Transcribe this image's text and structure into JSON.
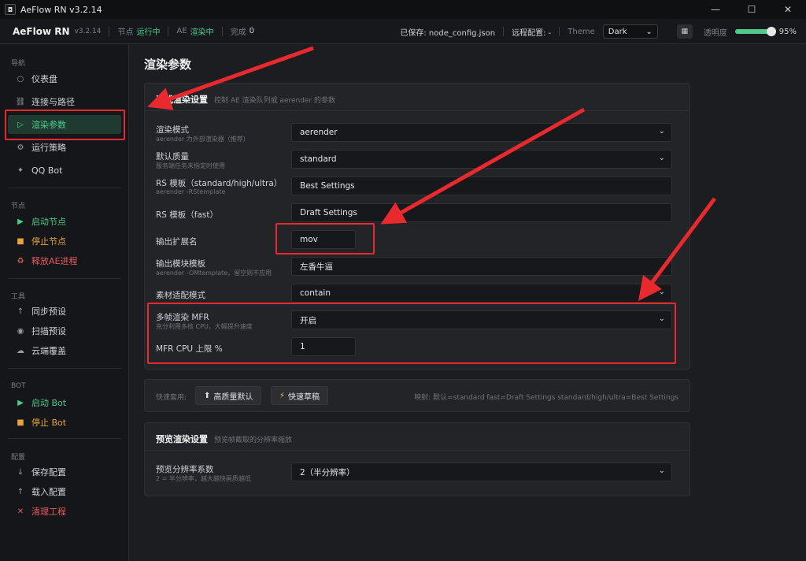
{
  "window": {
    "title": "AeFlow RN  v3.2.14",
    "logo_glyph": "◘"
  },
  "header": {
    "brand": "AeFlow RN",
    "version": "v3.2.14",
    "node_label": "节点",
    "node_value": "运行中",
    "ae_label": "AE",
    "ae_value": "渲染中",
    "done_label": "完成",
    "done_value": "0",
    "saved": "已保存: node_config.json",
    "remote": "远程配置: -",
    "theme_label": "Theme",
    "theme_value": "Dark",
    "opacity_label": "透明度",
    "opacity_value": "95%",
    "opacity_fraction": 0.95,
    "accent_color": "#4ecb8a"
  },
  "sidebar": {
    "sections": [
      {
        "title": "导航",
        "items": [
          {
            "label": "仪表盘",
            "icon": "circle-icon"
          },
          {
            "label": "连接与路径",
            "icon": "link-icon"
          },
          {
            "label": "渲染参数",
            "icon": "play-outline-icon",
            "active": true
          },
          {
            "label": "运行策略",
            "icon": "gear-icon"
          },
          {
            "label": "QQ Bot",
            "icon": "sparkle-icon"
          }
        ]
      },
      {
        "title": "节点",
        "items": [
          {
            "label": "启动节点",
            "icon": "play-icon"
          },
          {
            "label": "停止节点",
            "icon": "stop-icon"
          },
          {
            "label": "释放AE进程",
            "icon": "recycle-icon"
          }
        ]
      },
      {
        "title": "工具",
        "items": [
          {
            "label": "同步预设",
            "icon": "arrow-up-icon"
          },
          {
            "label": "扫描预设",
            "icon": "radio-icon"
          },
          {
            "label": "云端覆盖",
            "icon": "cloud-icon"
          }
        ]
      },
      {
        "title": "BOT",
        "items": [
          {
            "label": "启动 Bot",
            "icon": "play-icon"
          },
          {
            "label": "停止 Bot",
            "icon": "stop-icon"
          }
        ]
      },
      {
        "title": "配置",
        "items": [
          {
            "label": "保存配置",
            "icon": "arrow-down-icon"
          },
          {
            "label": "载入配置",
            "icon": "arrow-up-icon"
          },
          {
            "label": "清理工程",
            "icon": "close-icon"
          }
        ]
      }
    ]
  },
  "main": {
    "page_title": "渲染参数",
    "render_card": {
      "title": "正式渲染设置",
      "subtitle": "控制 AE 渲染队列或 aerender 的参数",
      "rows": [
        {
          "label": "渲染模式",
          "hint": "aerender 为外部渲染器（推荐）",
          "value": "aerender",
          "type": "select"
        },
        {
          "label": "默认质量",
          "hint": "服务端任务未指定时使用",
          "value": "standard",
          "type": "select"
        },
        {
          "label": "RS 模板（standard/high/ultra）",
          "hint": "aerender -RStemplate",
          "value": "Best Settings",
          "type": "input"
        },
        {
          "label": "RS 模板（fast）",
          "hint": "",
          "value": "Draft Settings",
          "type": "input"
        },
        {
          "label": "输出扩展名",
          "hint": "",
          "value": "mov",
          "type": "short"
        },
        {
          "label": "输出模块模板",
          "hint": "aerender -OMtemplate，留空则不应用",
          "value": "左香牛逼",
          "type": "input"
        },
        {
          "label": "素材适配模式",
          "hint": "",
          "value": "contain",
          "type": "select"
        },
        {
          "label": "多帧渲染 MFR",
          "hint": "充分利用多核 CPU，大幅提升速度",
          "value": "开启",
          "type": "select"
        },
        {
          "label": "MFR CPU 上限 %",
          "hint": "",
          "value": "1",
          "type": "short"
        }
      ]
    },
    "quick": {
      "label": "快速套用:",
      "btn_high": "高质量默认",
      "btn_draft": "快速草稿",
      "mapping": "映射: 默认=standard fast=Draft Settings standard/high/ultra=Best Settings"
    },
    "preview_card": {
      "title": "预览渲染设置",
      "subtitle": "预览帧截取的分辨率缩放",
      "row": {
        "label": "预览分辨率系数",
        "hint": "2 = 半分辨率，越大越快画质越低",
        "value": "2（半分辨率）"
      }
    }
  }
}
